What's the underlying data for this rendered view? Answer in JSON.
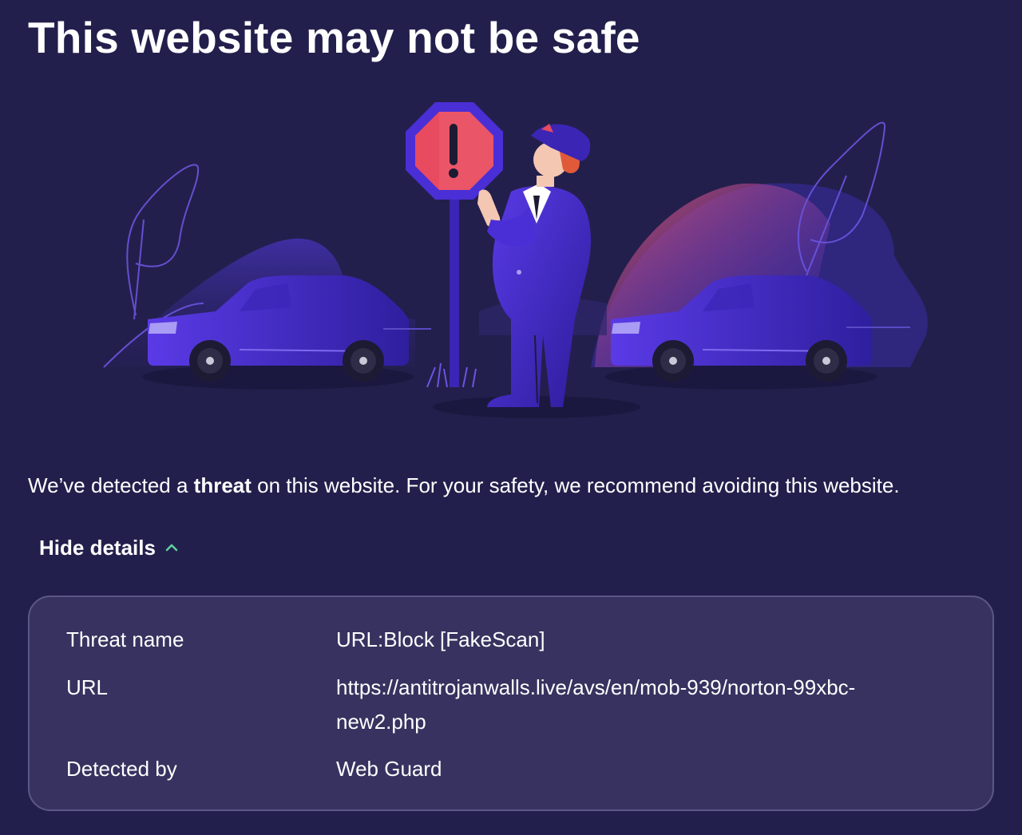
{
  "page": {
    "title": "This website may not be safe"
  },
  "message": {
    "before": "We’ve detected a ",
    "bold": "threat",
    "after": " on this website. For your safety, we recommend avoiding this website."
  },
  "details_toggle": {
    "label": "Hide details",
    "icon": "chevron-up-icon",
    "icon_color": "#5fd3a0"
  },
  "details": {
    "rows": [
      {
        "label": "Threat name",
        "value": "URL:Block [FakeScan]"
      },
      {
        "label": "URL",
        "value": "https://antitrojanwalls.live/avs/en/mob-939/norton-99xbc-new2.php"
      },
      {
        "label": "Detected by",
        "value": "Web Guard"
      }
    ]
  },
  "colors": {
    "background": "#231f4c",
    "panel": "#37325f",
    "panel_border": "#5b5786",
    "warning_sign": "#e84a5f",
    "accent_purple": "#4a2fd6"
  }
}
